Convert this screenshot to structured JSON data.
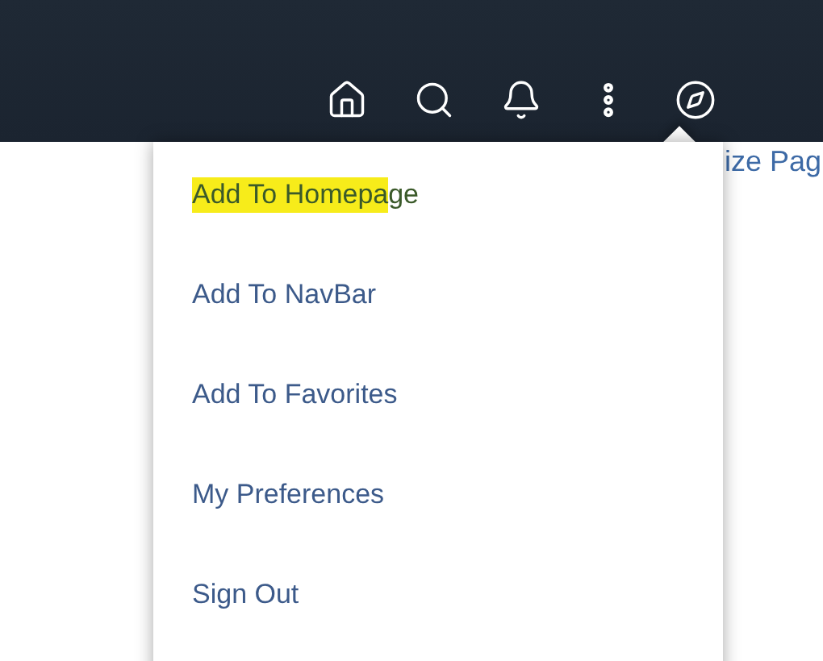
{
  "page_links": {
    "visible_text": "ize Pag"
  },
  "menu": {
    "items": [
      {
        "label": "Add To Homepage",
        "highlighted": true
      },
      {
        "label": "Add To NavBar",
        "highlighted": false
      },
      {
        "label": "Add To Favorites",
        "highlighted": false
      },
      {
        "label": "My Preferences",
        "highlighted": false
      },
      {
        "label": "Sign Out",
        "highlighted": false
      }
    ]
  }
}
